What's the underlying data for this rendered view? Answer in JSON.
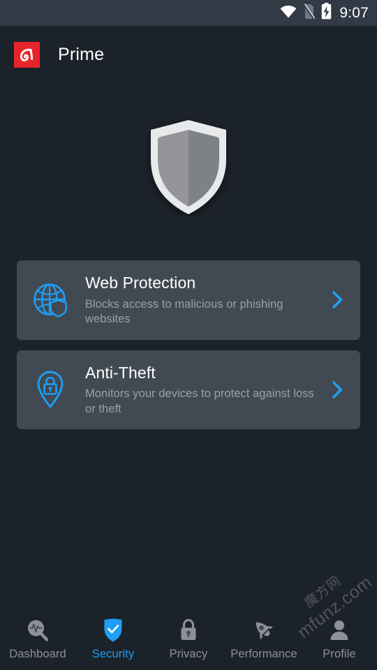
{
  "statusbar": {
    "time": "9:07",
    "icons": [
      {
        "name": "wifi-icon",
        "label": "wifi"
      },
      {
        "name": "sim-off-icon",
        "label": "no-sim"
      },
      {
        "name": "battery-charging-icon",
        "label": "battery-charging"
      }
    ]
  },
  "appbar": {
    "logo_name": "avira-logo-icon",
    "title": "Prime"
  },
  "hero": {
    "icon_name": "shield-icon",
    "colors": {
      "outline": "#e8e9ea",
      "fill_left": "#939598",
      "fill_right": "#808285"
    }
  },
  "cards": [
    {
      "icon_name": "globe-shield-icon",
      "title": "Web Protection",
      "subtitle": "Blocks access to malicious or phishing websites",
      "chevron_name": "chevron-right-icon"
    },
    {
      "icon_name": "map-pin-lock-icon",
      "title": "Anti-Theft",
      "subtitle": "Monitors your devices to protect against loss or theft",
      "chevron_name": "chevron-right-icon"
    }
  ],
  "bottomnav": {
    "items": [
      {
        "icon_name": "dashboard-magnifier-pulse-icon",
        "label": "Dashboard",
        "active": false
      },
      {
        "icon_name": "shield-check-icon",
        "label": "Security",
        "active": true
      },
      {
        "icon_name": "lock-icon",
        "label": "Privacy",
        "active": false
      },
      {
        "icon_name": "rocket-icon",
        "label": "Performance",
        "active": false
      },
      {
        "icon_name": "person-icon",
        "label": "Profile",
        "active": false
      }
    ]
  },
  "watermark": {
    "cn_text": "魔方网",
    "en_text": "mfunz.com"
  },
  "colors": {
    "background": "#1c2229",
    "statusbar_bg": "#323b45",
    "card_bg": "#414a52",
    "accent": "#1e9ef5",
    "brand_red": "#e8242a",
    "text_primary": "#ffffff",
    "text_secondary": "#9aa0a6",
    "nav_inactive": "#8b9197"
  }
}
